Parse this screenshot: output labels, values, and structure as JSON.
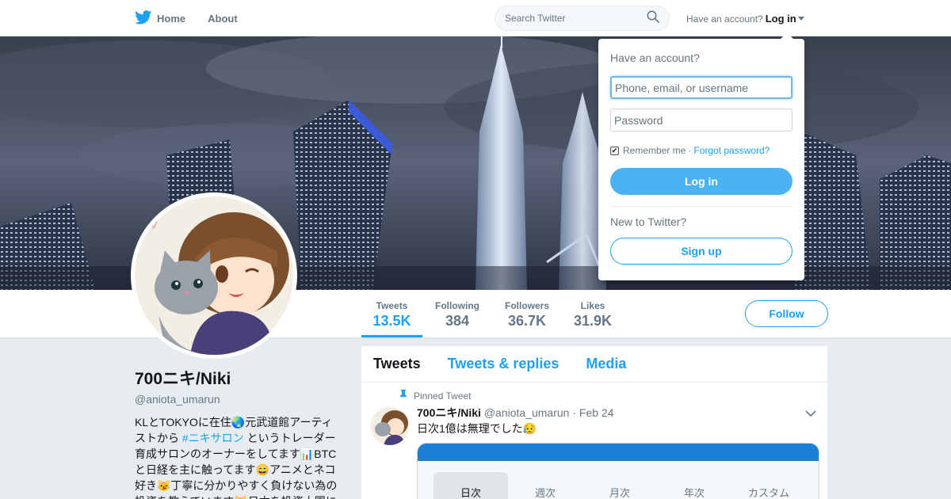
{
  "nav": {
    "home_label": "Home",
    "about_label": "About",
    "search_placeholder": "Search Twitter",
    "account_prompt": "Have an account?",
    "login_label": "Log in"
  },
  "stats": [
    {
      "label": "Tweets",
      "value": "13.5K",
      "active": true
    },
    {
      "label": "Following",
      "value": "384",
      "active": false
    },
    {
      "label": "Followers",
      "value": "36.7K",
      "active": false
    },
    {
      "label": "Likes",
      "value": "31.9K",
      "active": false
    }
  ],
  "follow_label": "Follow",
  "profile": {
    "name": "700ニキ/Niki",
    "handle": "@aniota_umarun",
    "bio_1": "KLとTOKYOに在住🌏元武道館アーティストから",
    "bio_hashtag": "#ニキサロン",
    "bio_2": " というトレーダー育成サロンのオーナーをしてます📊BTCと日経を主に触ってます😄アニメとネコ好き😼丁寧に分かりやすく負けない為の投資を教えています😺日本を投資大国に"
  },
  "timeline": {
    "tabs": [
      "Tweets",
      "Tweets & replies",
      "Media"
    ],
    "pinned_label": "Pinned Tweet",
    "tweet": {
      "name": "700ニキ/Niki",
      "handle": "@aniota_umarun",
      "date": "· Feb 24",
      "text": "日次1億は無理でした😥"
    },
    "media_tabs": [
      "日次",
      "週次",
      "月次",
      "年次",
      "カスタム"
    ]
  },
  "login": {
    "title": "Have an account?",
    "username_placeholder": "Phone, email, or username",
    "password_placeholder": "Password",
    "remember": "Remember me",
    "separator": "·",
    "forgot": "Forgot password?",
    "login_button": "Log in",
    "new_prompt": "New to Twitter?",
    "signup_button": "Sign up"
  },
  "colors": {
    "accent": "#1da1f2",
    "login_button": "#4ab3f4"
  }
}
